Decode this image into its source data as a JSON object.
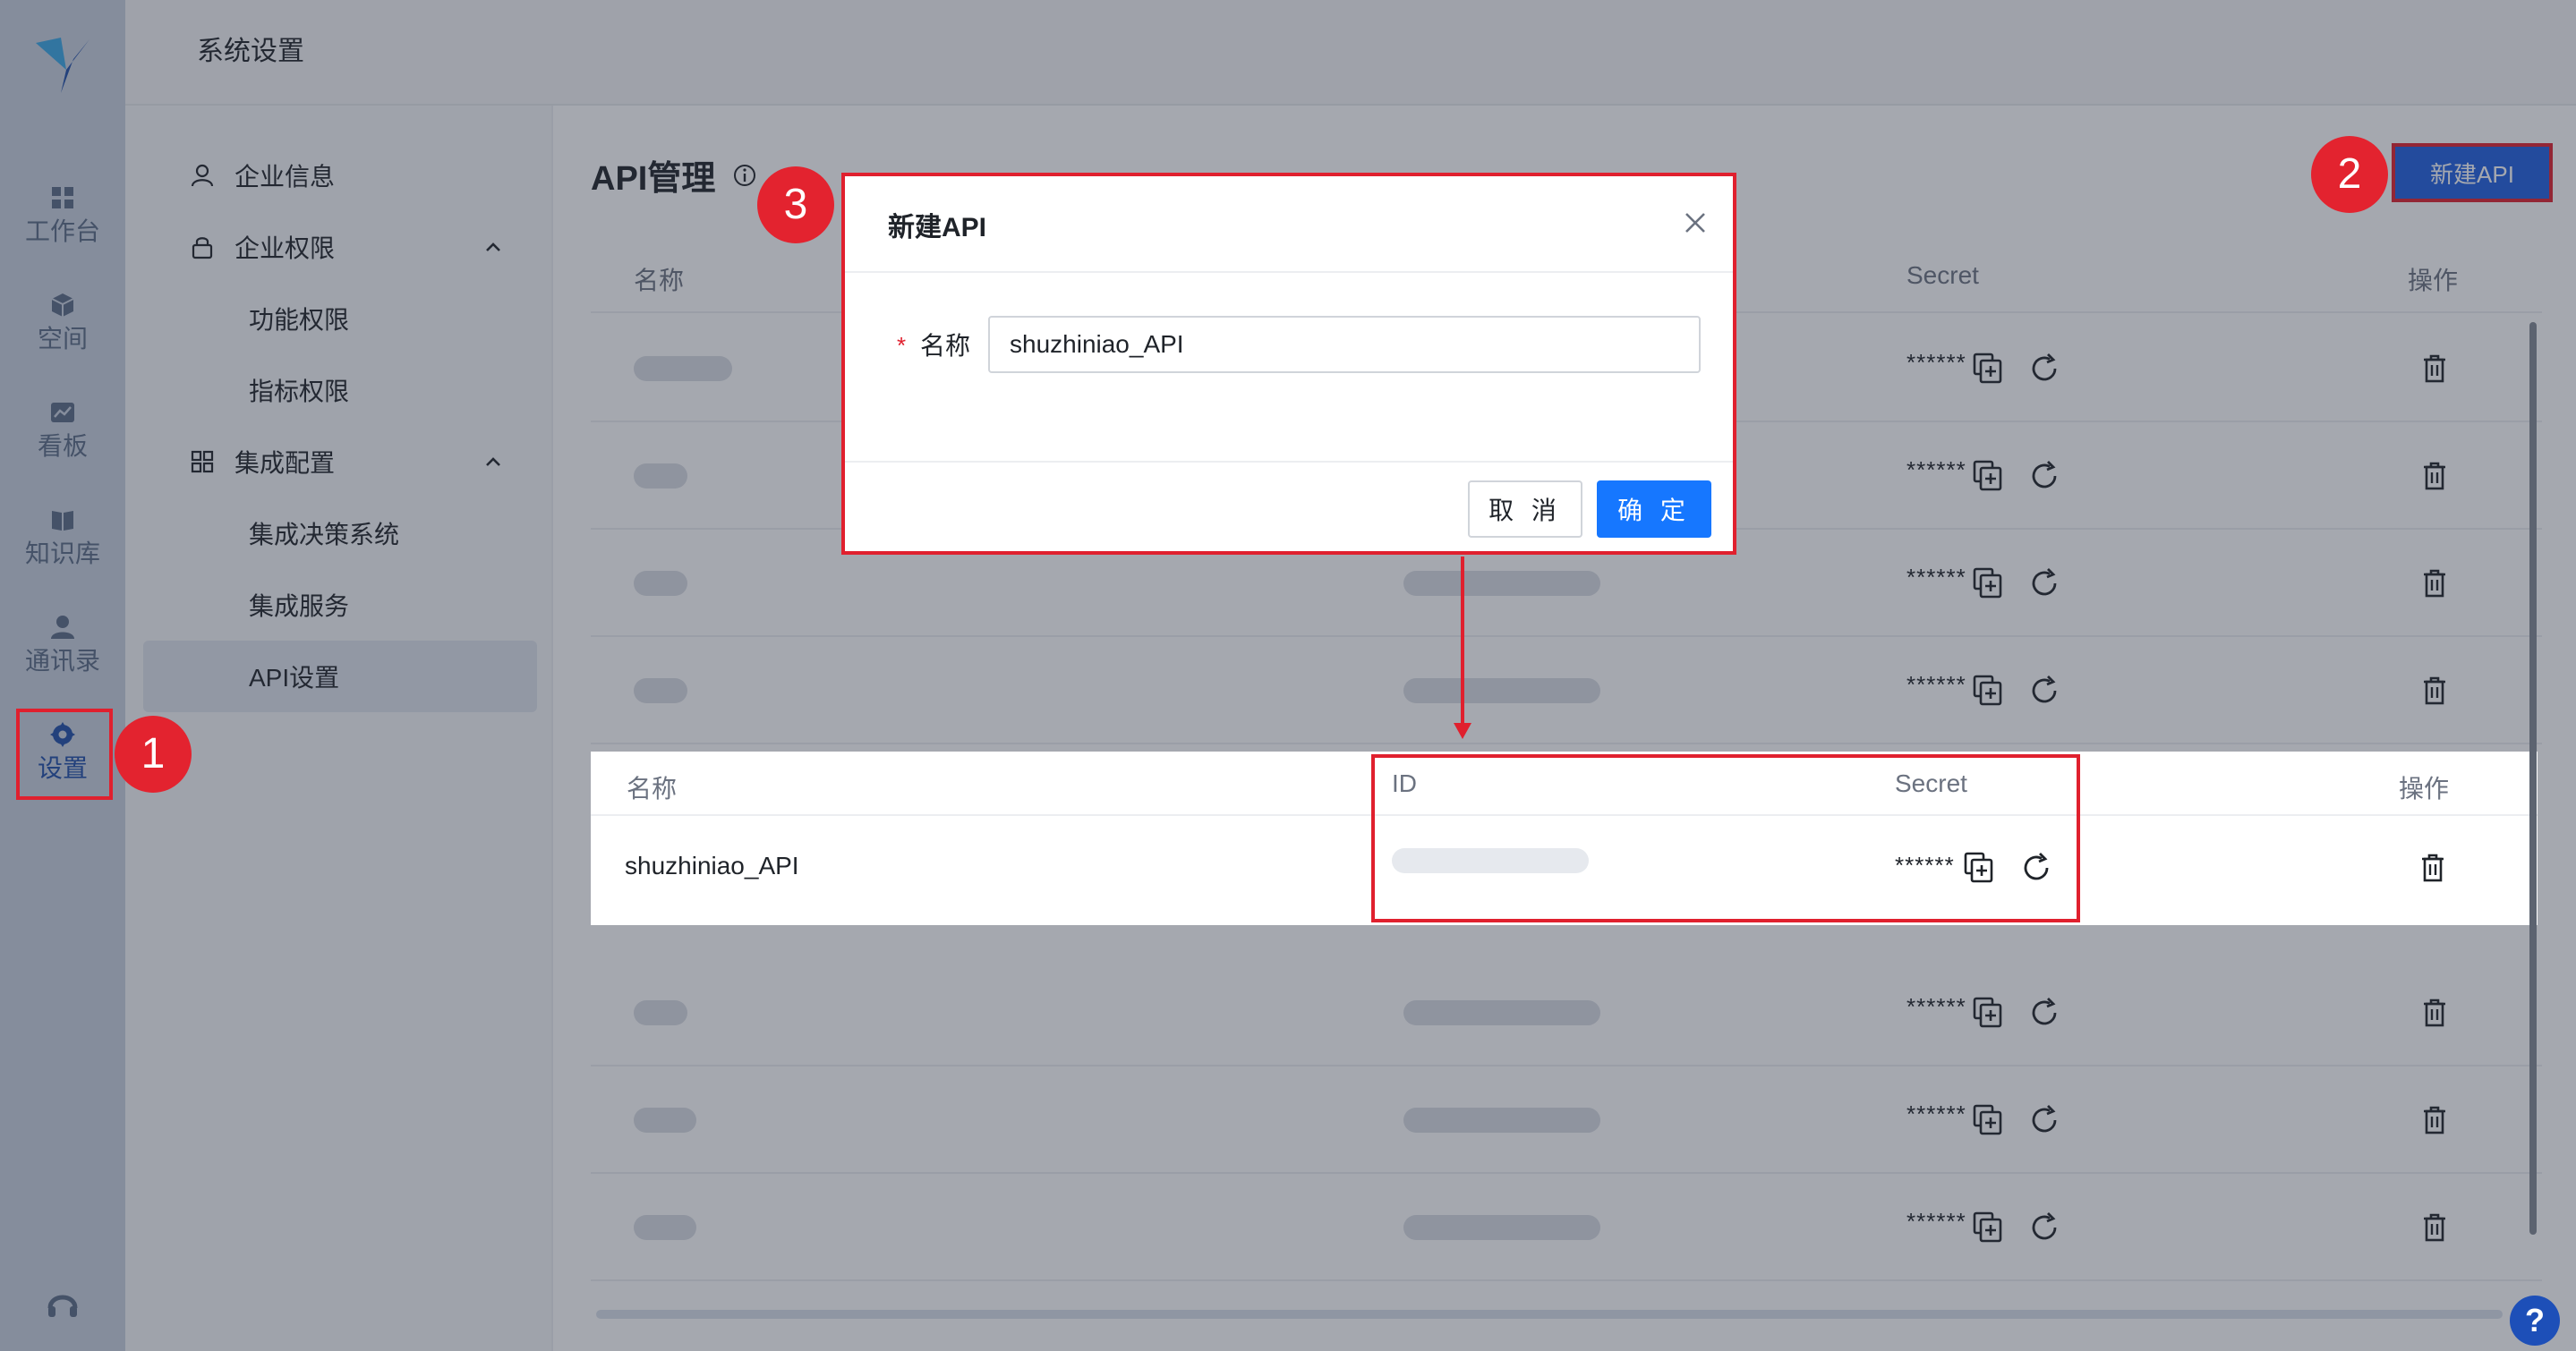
{
  "topbar": {
    "title": "系统设置"
  },
  "rail": {
    "items": [
      {
        "label": "工作台",
        "icon": "dashboard-icon"
      },
      {
        "label": "空间",
        "icon": "cube-icon"
      },
      {
        "label": "看板",
        "icon": "chart-board-icon"
      },
      {
        "label": "知识库",
        "icon": "book-icon"
      },
      {
        "label": "通讯录",
        "icon": "contacts-icon"
      },
      {
        "label": "设置",
        "icon": "gear-icon",
        "active": true
      }
    ]
  },
  "subnav": {
    "items": [
      {
        "label": "企业信息",
        "icon": "user-icon",
        "level": 1
      },
      {
        "label": "企业权限",
        "icon": "lock-icon",
        "level": 1,
        "expanded": true
      },
      {
        "label": "功能权限",
        "level": 2
      },
      {
        "label": "指标权限",
        "level": 2
      },
      {
        "label": "集成配置",
        "icon": "grid-icon",
        "level": 1,
        "expanded": true
      },
      {
        "label": "集成决策系统",
        "level": 2
      },
      {
        "label": "集成服务",
        "level": 2
      },
      {
        "label": "API设置",
        "level": 2,
        "active": true
      }
    ]
  },
  "main": {
    "heading": "API管理",
    "new_button": "新建API",
    "columns": {
      "name": "名称",
      "id": "ID",
      "secret": "Secret",
      "actions": "操作"
    },
    "secret_mask": "******"
  },
  "modal": {
    "title": "新建API",
    "required_mark": "*",
    "field_label": "名称",
    "field_value": "shuzhiniao_API",
    "cancel": "取 消",
    "confirm": "确 定"
  },
  "result": {
    "name": "shuzhiniao_API",
    "secret_mask": "******"
  },
  "badges": {
    "one": "1",
    "two": "2",
    "three": "3"
  },
  "help": {
    "label": "?"
  },
  "colors": {
    "primary": "#1677ff",
    "highlight": "#e0202e",
    "rail_bg": "#c9d1de"
  }
}
